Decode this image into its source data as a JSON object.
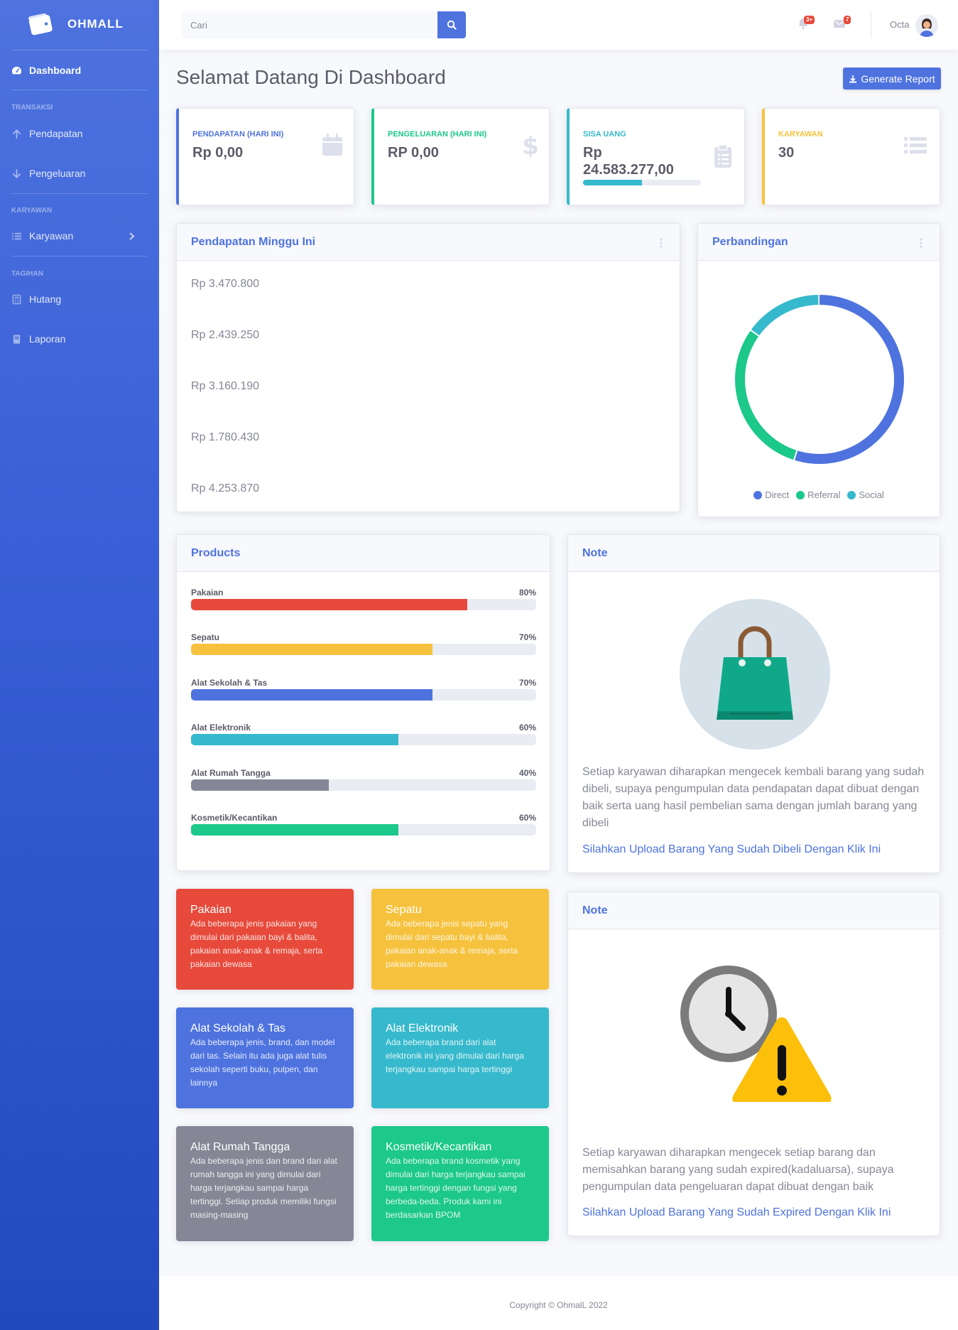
{
  "brand": {
    "name": "OHMALL"
  },
  "sidebar": {
    "dashboard": "Dashboard",
    "sections": {
      "transaksi": "TRANSAKSI",
      "karyawan": "KARYAWAN",
      "tagihan": "TAGIHAN"
    },
    "items": {
      "pendapatan": "Pendapatan",
      "pengeluaran": "Pengeluaran",
      "karyawan": "Karyawan",
      "hutang": "Hutang",
      "laporan": "Laporan"
    }
  },
  "topbar": {
    "search_placeholder": "Cari",
    "alerts_badge": "3+",
    "messages_badge": "7",
    "user_name": "Octa"
  },
  "page": {
    "title": "Selamat Datang Di Dashboard",
    "report_button": "Generate Report"
  },
  "stats": [
    {
      "label": "PENDAPATAN (HARI INI)",
      "value": "Rp 0,00",
      "color": "#4e73df",
      "icon": "calendar-icon"
    },
    {
      "label": "PENGELUARAN (HARI INI)",
      "value": "RP 0,00",
      "color": "#1cc88a",
      "icon": "dollar-icon"
    },
    {
      "label": "SISA UANG",
      "value_line1": "Rp",
      "value_line2": "24.583.277,00",
      "progress": 0.5,
      "color": "#36b9cc",
      "icon": "clipboard-icon"
    },
    {
      "label": "KARYAWAN",
      "value": "30",
      "color": "#f6c23e",
      "icon": "list-icon"
    }
  ],
  "weekly": {
    "title": "Pendapatan Minggu Ini",
    "items": [
      "Rp 3.470.800",
      "Rp 2.439.250",
      "Rp 3.160.190",
      "Rp 1.780.430",
      "Rp 4.253.870"
    ]
  },
  "comparison": {
    "title": "Perbandingan",
    "legend": [
      {
        "name": "Direct",
        "color": "#4e73df"
      },
      {
        "name": "Referral",
        "color": "#1cc88a"
      },
      {
        "name": "Social",
        "color": "#36b9cc"
      }
    ],
    "chart_data": {
      "type": "pie",
      "categories": [
        "Direct",
        "Referral",
        "Social"
      ],
      "values": [
        55,
        30,
        15
      ]
    }
  },
  "products": {
    "title": "Products",
    "items": [
      {
        "name": "Pakaian",
        "percent_label": "80%",
        "value": 80,
        "color": "#e74a3b"
      },
      {
        "name": "Sepatu",
        "percent_label": "70%",
        "value": 70,
        "color": "#f6c23e"
      },
      {
        "name": "Alat Sekolah & Tas",
        "percent_label": "70%",
        "value": 70,
        "color": "#4e73df"
      },
      {
        "name": "Alat Elektronik",
        "percent_label": "60%",
        "value": 60,
        "color": "#36b9cc"
      },
      {
        "name": "Alat Rumah Tangga",
        "percent_label": "40%",
        "value": 40,
        "color": "#858796"
      },
      {
        "name": "Kosmetik/Kecantikan",
        "percent_label": "60%",
        "value": 60,
        "color": "#1cc88a"
      }
    ]
  },
  "note1": {
    "title": "Note",
    "text": "Setiap karyawan diharapkan mengecek kembali barang yang sudah dibeli, supaya pengumpulan data pendapatan dapat dibuat dengan baik serta uang hasil pembelian sama dengan jumlah barang yang dibeli",
    "link": "Silahkan Upload Barang Yang Sudah Dibeli Dengan Klik Ini"
  },
  "note2": {
    "title": "Note",
    "text": "Setiap karyawan diharapkan mengecek setiap barang dan memisahkan barang yang sudah expired(kadaluarsa), supaya pengumpulan data pengeluaran dapat dibuat dengan baik",
    "link": "Silahkan Upload Barang Yang Sudah Expired Dengan Klik Ini"
  },
  "categories": [
    {
      "title": "Pakaian",
      "desc": "Ada beberapa jenis pakaian yang dimulai dari pakaian bayi & balita, pakaian anak-anak & remaja, serta pakaian dewasa",
      "color": "#e74a3b"
    },
    {
      "title": "Sepatu",
      "desc": "Ada beberapa jenis sepatu yang dimulai dari sepatu bayi & balita, pakaian anak-anak & remaja, serta pakaian dewasa",
      "color": "#f6c23e"
    },
    {
      "title": "Alat Sekolah & Tas",
      "desc": "Ada beberapa jenis, brand, dan model dari tas. Selain itu ada juga alat tulis sekolah seperti buku, pulpen, dan lainnya",
      "color": "#4e73df"
    },
    {
      "title": "Alat Elektronik",
      "desc": "Ada beberapa brand dari alat elektronik ini yang dimulai dari harga terjangkau sampai harga tertinggi",
      "color": "#36b9cc"
    },
    {
      "title": "Alat Rumah Tangga",
      "desc": "Ada beberapa jenis dan brand dari alat rumah tangga ini yang dimulai dari harga terjangkau sampai harga tertinggi. Setiap produk memiliki fungsi masing-masing",
      "color": "#858796"
    },
    {
      "title": "Kosmetik/Kecantikan",
      "desc": "Ada beberapa brand kosmetik yang dimulai dari harga terjangkau sampai harga tertinggi dengan fungsi yang berbeda-beda. Produk kami ini berdasarkan BPOM",
      "color": "#1cc88a"
    }
  ],
  "footer": {
    "copyright": "Copyright © OhmalL 2022"
  }
}
